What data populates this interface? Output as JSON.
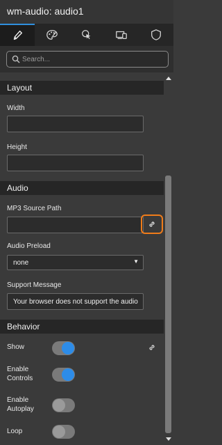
{
  "window": {
    "title": "wm-audio: audio1"
  },
  "tabs": [
    {
      "icon": "pencil-icon",
      "active": true
    },
    {
      "icon": "palette-icon",
      "active": false
    },
    {
      "icon": "cursor-click-icon",
      "active": false
    },
    {
      "icon": "devices-icon",
      "active": false
    },
    {
      "icon": "shield-icon",
      "active": false
    }
  ],
  "search": {
    "placeholder": "Search...",
    "value": ""
  },
  "layout": {
    "heading": "Layout",
    "width_label": "Width",
    "width_value": "",
    "height_label": "Height",
    "height_value": ""
  },
  "audio": {
    "heading": "Audio",
    "mp3_label": "MP3 Source Path",
    "mp3_value": "",
    "preload_label": "Audio Preload",
    "preload_value": "none",
    "support_label": "Support Message",
    "support_value": "Your browser does not support the audio"
  },
  "behavior": {
    "heading": "Behavior",
    "show_label": "Show",
    "show_on": true,
    "controls_label": "Enable Controls",
    "controls_on": true,
    "autoplay_label": "Enable Autoplay",
    "autoplay_on": false,
    "loop_label": "Loop",
    "loop_on": false
  },
  "colors": {
    "accent": "#2d8ce8",
    "highlight": "#f07c1a",
    "panel": "#3a3a3a",
    "section": "#262626"
  }
}
